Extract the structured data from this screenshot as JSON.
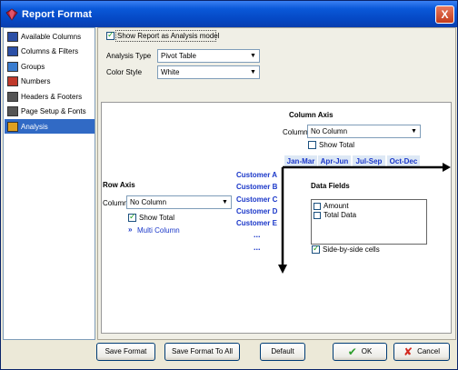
{
  "window": {
    "title": "Report Format",
    "close_glyph": "X"
  },
  "sidebar": {
    "items": [
      {
        "label": "Available Columns",
        "icon": "available-columns-icon",
        "color": "#2b4fa6"
      },
      {
        "label": "Columns & Filters",
        "icon": "columns-filters-icon",
        "color": "#2b4fa6"
      },
      {
        "label": "Groups",
        "icon": "groups-icon",
        "color": "#3a7dd0"
      },
      {
        "label": "Numbers",
        "icon": "numbers-icon",
        "color": "#c0392b"
      },
      {
        "label": "Headers & Footers",
        "icon": "headers-footers-icon",
        "color": "#555555"
      },
      {
        "label": "Page Setup & Fonts",
        "icon": "page-setup-icon",
        "color": "#555555"
      },
      {
        "label": "Analysis",
        "icon": "analysis-icon",
        "color": "#e0a020",
        "selected": true
      }
    ]
  },
  "analysis": {
    "show_model_label": "Show Report as Analysis model",
    "show_model_checked": true,
    "analysis_type_label": "Analysis Type",
    "analysis_type_value": "Pivot Table",
    "color_style_label": "Color Style",
    "color_style_value": "White"
  },
  "preview": {
    "column_axis_title": "Column Axis",
    "column_label": "Column",
    "column_value": "No Column",
    "column_show_total_label": "Show Total",
    "column_show_total_checked": false,
    "column_headers": [
      "Jan-Mar",
      "Apr-Jun",
      "Jul-Sep",
      "Oct-Dec"
    ],
    "row_axis_title": "Row Axis",
    "row_column_label": "Column",
    "row_column_value": "No Column",
    "row_show_total_label": "Show Total",
    "row_show_total_checked": true,
    "multi_column_label": "Multi Column",
    "row_headers": [
      "Customer A",
      "Customer B",
      "Customer C",
      "Customer D",
      "Customer E"
    ],
    "ellipsis": "...",
    "data_fields_title": "Data Fields",
    "data_fields": [
      {
        "label": "Amount",
        "checked": false
      },
      {
        "label": "Total Data",
        "checked": false
      }
    ],
    "side_by_side_label": "Side-by-side cells",
    "side_by_side_checked": true,
    "accent_color": "#1a37c9"
  },
  "buttons": {
    "save_format": "Save Format",
    "save_format_all": "Save Format To All",
    "default": "Default",
    "ok": "OK",
    "cancel": "Cancel"
  }
}
